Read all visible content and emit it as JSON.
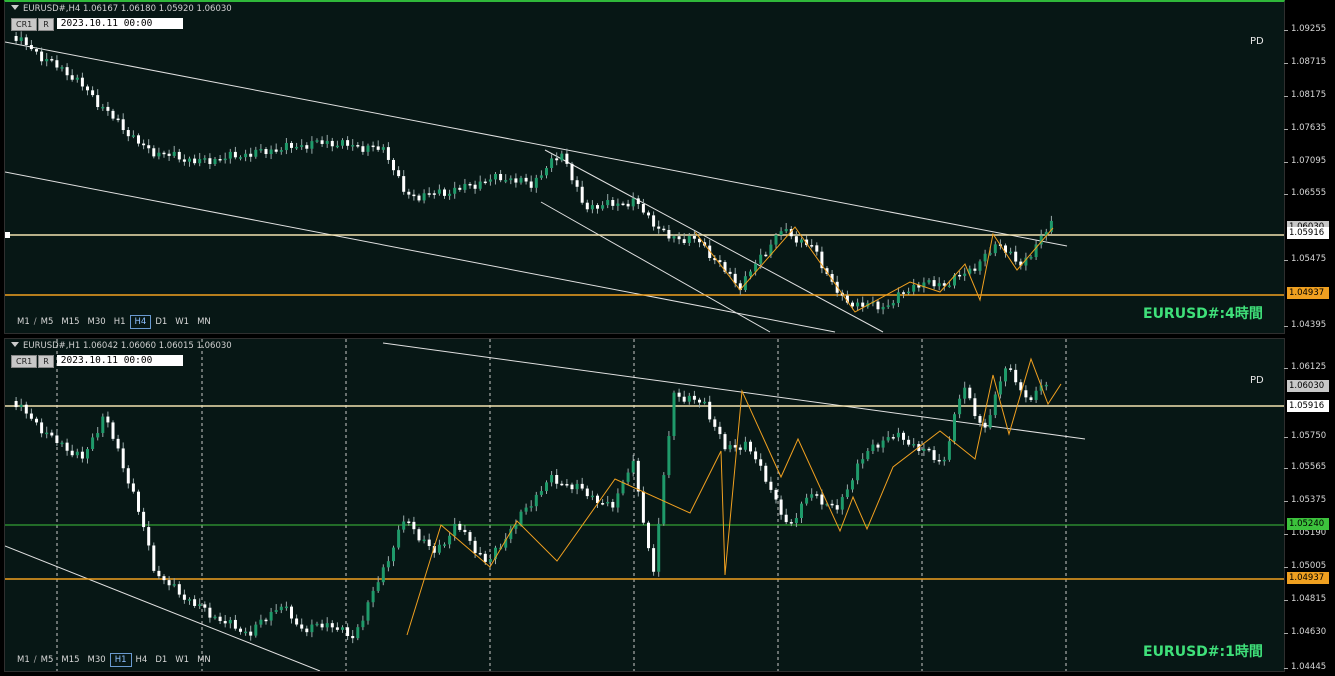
{
  "top_pane": {
    "header": "EURUSD#,H4  1.06167 1.06180 1.05920 1.06030",
    "btn_cr1": "CR1",
    "btn_r": "R",
    "date": "2023.10.11 00:00",
    "pd_label": "PD",
    "pane_label": "EURUSD#:4時間",
    "timeframes": [
      "M1",
      "/",
      "M5",
      "M15",
      "M30",
      "H1",
      "H4",
      "D1",
      "W1",
      "MN"
    ],
    "active_tf": "H4",
    "price_ticks": [
      "1.09255",
      "1.08715",
      "1.08175",
      "1.07635",
      "1.07095",
      "1.06555",
      "1.05475",
      "1.04395"
    ],
    "level_upper": "1.05916",
    "level_lower": "1.04937",
    "current_price": "1.06030",
    "colors": {
      "upper_level": "#f2e2b0",
      "lower_level": "#f0a020",
      "bull": "#1f9a6a",
      "bear": "#ffffff"
    }
  },
  "bottom_pane": {
    "header": "EURUSD#,H1  1.06042 1.06060 1.06015 1.06030",
    "btn_cr1": "CR1",
    "btn_r": "R",
    "date": "2023.10.11 00:00",
    "pd_label": "PD",
    "pane_label": "EURUSD#:1時間",
    "timeframes": [
      "M1",
      "/",
      "M5",
      "M15",
      "M30",
      "H1",
      "H4",
      "D1",
      "W1",
      "MN"
    ],
    "active_tf": "H1",
    "price_ticks": [
      "1.06125",
      "1.05750",
      "1.05565",
      "1.05375",
      "1.05190",
      "1.05005",
      "1.04815",
      "1.04630",
      "1.04445"
    ],
    "current_price": "1.06030",
    "level_upper": "1.05916",
    "level_mid": "1.05240",
    "level_lower": "1.04937",
    "colors": {
      "upper_level": "#f2e2b0",
      "mid_level": "#3cc23c",
      "lower_level": "#f0a020",
      "bull": "#1f9a6a",
      "bear": "#ffffff"
    }
  }
}
